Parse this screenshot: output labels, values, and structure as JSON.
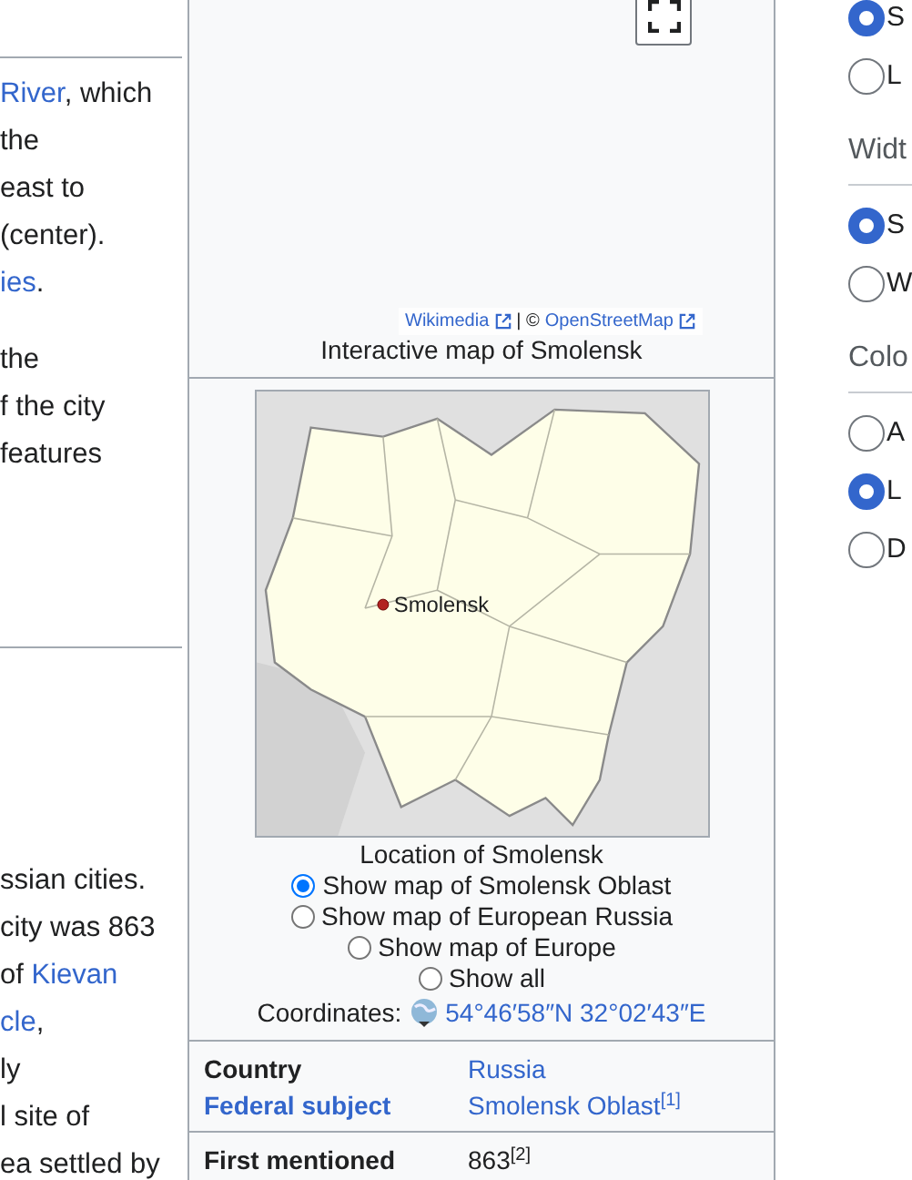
{
  "article": {
    "upper_lines": [
      [
        {
          "text": "River",
          "link": true
        },
        {
          "text": ", which",
          "link": false
        }
      ],
      [
        {
          "text": "the",
          "link": false
        }
      ],
      [
        {
          "text": " east to",
          "link": false
        }
      ],
      [
        {
          "text": " (center).",
          "link": false
        }
      ],
      [
        {
          "text": "ies",
          "link": true
        },
        {
          "text": ".",
          "link": false
        }
      ]
    ],
    "middle_lines": [
      [
        {
          "text": "the",
          "link": false
        }
      ],
      [
        {
          "text": "f the city",
          "link": false
        }
      ],
      [
        {
          "text": " features",
          "link": false
        }
      ]
    ],
    "lower_lines": [
      [
        {
          "text": "ssian cities.",
          "link": false
        }
      ],
      [
        {
          "text": "city was 863",
          "link": false
        }
      ],
      [
        {
          "text": "of ",
          "link": false
        },
        {
          "text": "Kievan",
          "link": true
        }
      ],
      [
        {
          "text": "cle",
          "link": true
        },
        {
          "text": ",",
          "link": false
        }
      ],
      [
        {
          "text": "ly",
          "link": false
        }
      ],
      [
        {
          "text": "l site of",
          "link": false
        }
      ],
      [
        {
          "text": "ea settled by",
          "link": false
        }
      ]
    ]
  },
  "infobox": {
    "interactive_map": {
      "attribution": [
        {
          "text": "Wikimedia",
          "link": true
        },
        {
          "text": "| ©",
          "link": false
        },
        {
          "text": "OpenStreetMap",
          "link": true
        }
      ],
      "caption": "Interactive map of Smolensk"
    },
    "locator_map": {
      "marker_label": "Smolensk",
      "caption": "Location of Smolensk",
      "options": [
        {
          "label": "Show map of Smolensk Oblast",
          "selected": true
        },
        {
          "label": "Show map of European Russia",
          "selected": false
        },
        {
          "label": "Show map of Europe",
          "selected": false
        },
        {
          "label": "Show all",
          "selected": false
        }
      ],
      "coordinates_label": "Coordinates:",
      "coordinates": "54°46′58″N 32°02′43″E"
    },
    "row_groups": [
      [
        {
          "label": "Country",
          "label_link": false,
          "value": "Russia",
          "value_link": true
        },
        {
          "label": "Federal subject",
          "label_link": true,
          "value": "Smolensk Oblast$^{[1]}$",
          "value_link": true
        }
      ],
      [
        {
          "label": "First mentioned",
          "label_link": false,
          "value": "863$^{[2]}$",
          "value_link": false
        }
      ]
    ]
  },
  "appearance_panel": {
    "groups": [
      {
        "options": [
          {
            "label": "S",
            "selected": true
          },
          {
            "label": "L",
            "selected": false
          }
        ]
      },
      {
        "heading": "Widt",
        "options": [
          {
            "label": "S",
            "selected": true
          },
          {
            "label": "W",
            "selected": false
          }
        ]
      },
      {
        "heading": "Colo",
        "options": [
          {
            "label": "A",
            "selected": false
          },
          {
            "label": "L",
            "selected": true
          },
          {
            "label": "D",
            "selected": false
          }
        ]
      }
    ]
  }
}
